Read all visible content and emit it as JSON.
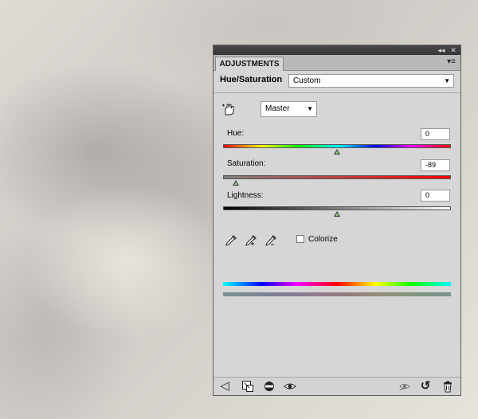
{
  "panel": {
    "tab_label": "ADJUSTMENTS",
    "collapse_glyph": "◂◂",
    "close_glyph": "✕",
    "menu_glyph": "▾≡"
  },
  "adjustment": {
    "name": "Hue/Saturation",
    "preset": "Custom",
    "channel": "Master",
    "arrow_glyph": "▼"
  },
  "sliders": {
    "hue": {
      "label": "Hue:",
      "value": "0",
      "position": 0.5
    },
    "saturation": {
      "label": "Saturation:",
      "value": "-89",
      "position": 0.055
    },
    "lightness": {
      "label": "Lightness:",
      "value": "0",
      "position": 0.5
    }
  },
  "colorize": {
    "label": "Colorize",
    "checked": false
  },
  "footer_glyphs": {
    "back": "◁",
    "reset": "↺"
  },
  "icons": [
    "hand-adjust-icon",
    "eyedropper-icon",
    "eyedropper-plus-icon",
    "eyedropper-minus-icon",
    "back-arrow-icon",
    "clip-to-layer-icon",
    "visibility-toggle-icon",
    "eye-icon",
    "view-previous-icon",
    "reset-icon",
    "trash-icon"
  ]
}
